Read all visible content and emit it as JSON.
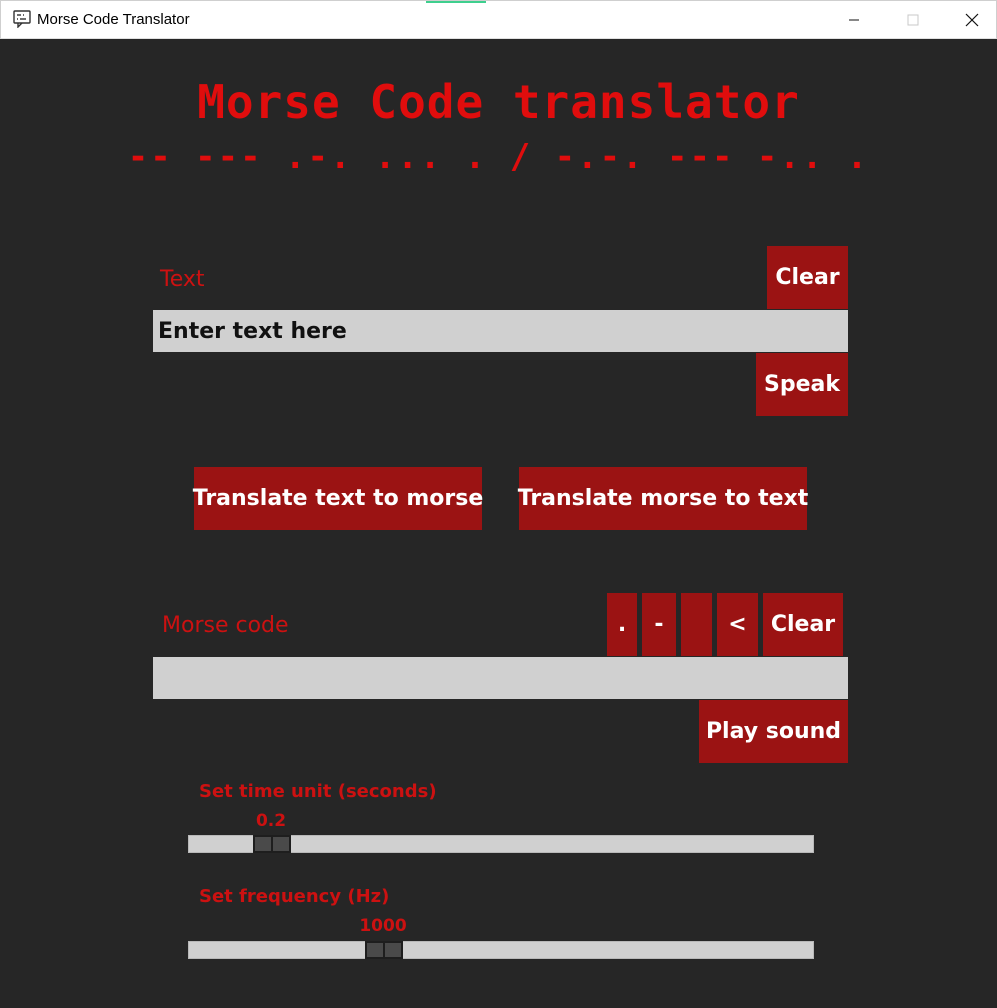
{
  "window": {
    "title": "Morse Code Translator"
  },
  "header": {
    "title": "Morse Code translator",
    "morse_title": "-- --- .-. ... . / -.-. --- -.. ."
  },
  "text_section": {
    "label": "Text",
    "clear_label": "Clear",
    "input_value": "Enter text here",
    "speak_label": "Speak"
  },
  "translate": {
    "to_morse_label": "Translate text to morse",
    "to_text_label": "Translate morse to text"
  },
  "morse_section": {
    "label": "Morse code",
    "dot_label": ".",
    "dash_label": "-",
    "space_label": " ",
    "backspace_label": "<",
    "clear_label": "Clear",
    "input_value": "",
    "play_label": "Play sound"
  },
  "time_slider": {
    "label": "Set time unit (seconds)",
    "value": "0.2",
    "fraction": 0.11
  },
  "freq_slider": {
    "label": "Set frequency (Hz)",
    "value": "1000",
    "fraction": 0.3
  },
  "colors": {
    "accent_red": "#e00d0d",
    "button_bg": "#9b1313",
    "background": "#262626",
    "field_bg": "#d0d0d0"
  }
}
